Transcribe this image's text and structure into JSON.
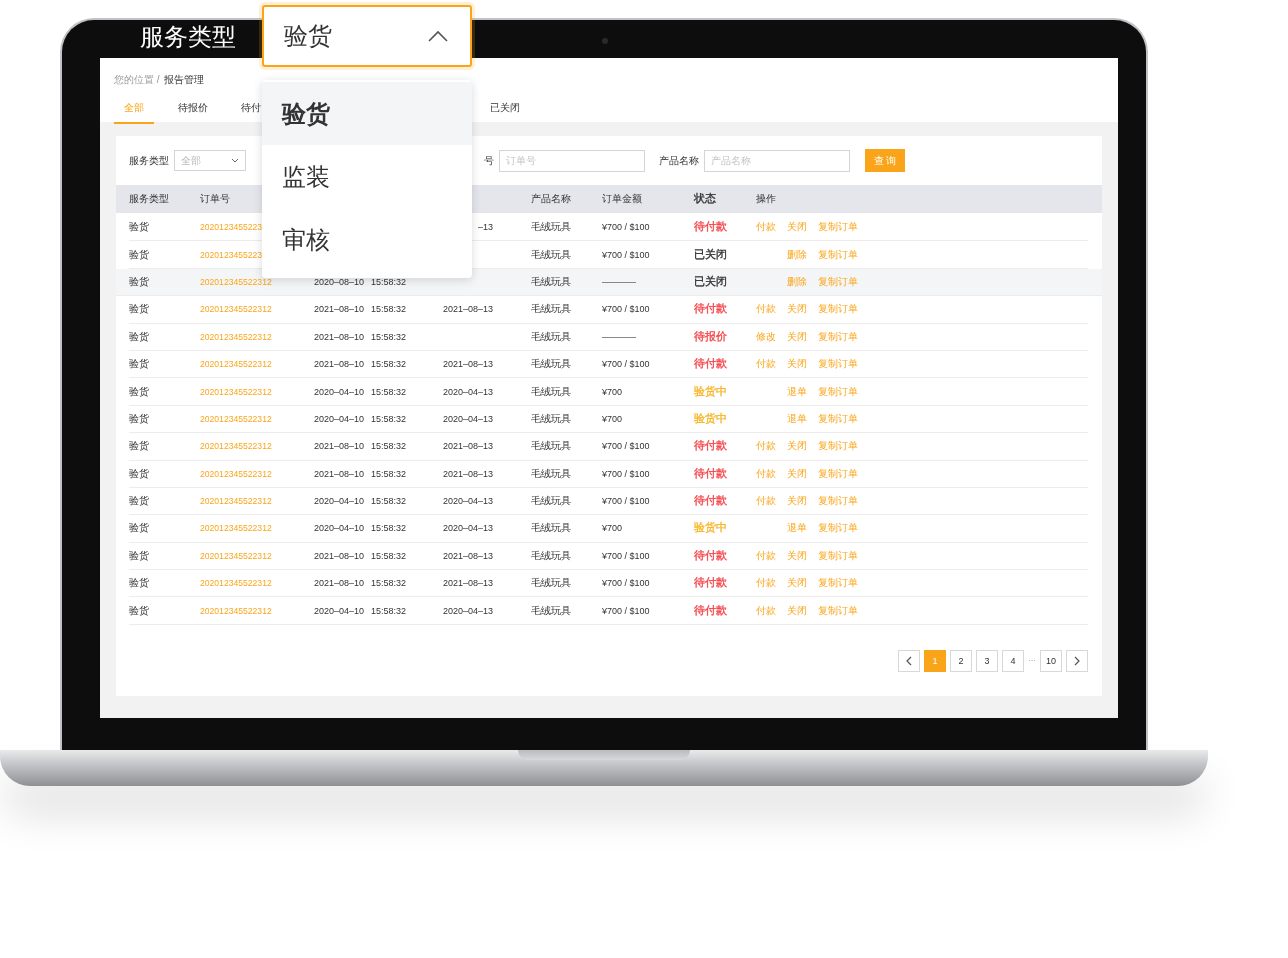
{
  "zoom_overlay": {
    "label": "服务类型",
    "field": {
      "value": "验货",
      "expanded": true
    },
    "options": [
      {
        "label": "验货",
        "selected": true
      },
      {
        "label": "监装",
        "selected": false
      },
      {
        "label": "审核",
        "selected": false
      }
    ]
  },
  "breadcrumb": {
    "trail": "您的位置 /",
    "current": "报告管理"
  },
  "tabs": [
    {
      "label": "全部",
      "selected": true
    },
    {
      "label": "待报价",
      "selected": false
    },
    {
      "label": "待付",
      "selected": false
    },
    {
      "label": "已关闭",
      "selected": false
    }
  ],
  "filters": {
    "service_label": "服务类型",
    "service_value": "全部",
    "order_label": "号",
    "order_placeholder": "订单号",
    "product_label": "产品名称",
    "product_placeholder": "产品名称",
    "search_button": "查 询"
  },
  "table": {
    "columns": [
      "服务类型",
      "订单号",
      "产品名称",
      "订单金额",
      "状态",
      "操作"
    ],
    "rows": [
      {
        "service": "验货",
        "order": "2020123455223",
        "deadline": "–13",
        "product": "毛绒玩具",
        "amount": "¥700 / $100",
        "status": {
          "label": "待付款",
          "color": "#f5464b"
        },
        "actions": [
          "付款",
          "关闭",
          "复制订单"
        ],
        "hovered": false
      },
      {
        "service": "验货",
        "order": "2020123455223",
        "product": "毛绒玩具",
        "amount": "¥700 / $100",
        "status": {
          "label": "已关闭",
          "color": "#333333"
        },
        "actions": [
          "删除",
          "复制订单"
        ],
        "hovered": false
      },
      {
        "service": "验货",
        "order": "202012345522312",
        "date": "2020–08–10",
        "time": "15:58:32",
        "product": "毛绒玩具",
        "status": {
          "label": "已关闭",
          "color": "#333333"
        },
        "actions": [
          "删除",
          "复制订单"
        ],
        "hovered": true
      },
      {
        "service": "验货",
        "order": "202012345522312",
        "date": "2021–08–10",
        "time": "15:58:32",
        "deadline": "2021–08–13",
        "product": "毛绒玩具",
        "amount": "¥700 / $100",
        "status": {
          "label": "待付款",
          "color": "#f5464b"
        },
        "actions": [
          "付款",
          "关闭",
          "复制订单"
        ],
        "hovered": false
      },
      {
        "service": "验货",
        "order": "202012345522312",
        "date": "2021–08–10",
        "time": "15:58:32",
        "product": "毛绒玩具",
        "status": {
          "label": "待报价",
          "color": "#f5464b"
        },
        "actions": [
          "修改",
          "关闭",
          "复制订单"
        ],
        "hovered": false
      },
      {
        "service": "验货",
        "order": "202012345522312",
        "date": "2021–08–10",
        "time": "15:58:32",
        "deadline": "2021–08–13",
        "product": "毛绒玩具",
        "amount": "¥700 / $100",
        "status": {
          "label": "待付款",
          "color": "#f5464b"
        },
        "actions": [
          "付款",
          "关闭",
          "复制订单"
        ],
        "hovered": false
      },
      {
        "service": "验货",
        "order": "202012345522312",
        "date": "2020–04–10",
        "time": "15:58:32",
        "deadline": "2020–04–13",
        "product": "毛绒玩具",
        "amount": "¥700",
        "status": {
          "label": "验货中",
          "color": "#f8b526"
        },
        "actions": [
          "退单",
          "复制订单"
        ],
        "hovered": false
      },
      {
        "service": "验货",
        "order": "202012345522312",
        "date": "2020–04–10",
        "time": "15:58:32",
        "deadline": "2020–04–13",
        "product": "毛绒玩具",
        "amount": "¥700",
        "status": {
          "label": "验货中",
          "color": "#f8b526"
        },
        "actions": [
          "退单",
          "复制订单"
        ],
        "hovered": false
      },
      {
        "service": "验货",
        "order": "202012345522312",
        "date": "2021–08–10",
        "time": "15:58:32",
        "deadline": "2021–08–13",
        "product": "毛绒玩具",
        "amount": "¥700 / $100",
        "status": {
          "label": "待付款",
          "color": "#f5464b"
        },
        "actions": [
          "付款",
          "关闭",
          "复制订单"
        ],
        "hovered": false
      },
      {
        "service": "验货",
        "order": "202012345522312",
        "date": "2021–08–10",
        "time": "15:58:32",
        "deadline": "2021–08–13",
        "product": "毛绒玩具",
        "amount": "¥700 / $100",
        "status": {
          "label": "待付款",
          "color": "#f5464b"
        },
        "actions": [
          "付款",
          "关闭",
          "复制订单"
        ],
        "hovered": false
      },
      {
        "service": "验货",
        "order": "202012345522312",
        "date": "2020–04–10",
        "time": "15:58:32",
        "deadline": "2020–04–13",
        "product": "毛绒玩具",
        "amount": "¥700 / $100",
        "status": {
          "label": "待付款",
          "color": "#f5464b"
        },
        "actions": [
          "付款",
          "关闭",
          "复制订单"
        ],
        "hovered": false
      },
      {
        "service": "验货",
        "order": "202012345522312",
        "date": "2020–04–10",
        "time": "15:58:32",
        "deadline": "2020–04–13",
        "product": "毛绒玩具",
        "amount": "¥700",
        "status": {
          "label": "验货中",
          "color": "#f8b526"
        },
        "actions": [
          "退单",
          "复制订单"
        ],
        "hovered": false
      },
      {
        "service": "验货",
        "order": "202012345522312",
        "date": "2021–08–10",
        "time": "15:58:32",
        "deadline": "2021–08–13",
        "product": "毛绒玩具",
        "amount": "¥700 / $100",
        "status": {
          "label": "待付款",
          "color": "#f5464b"
        },
        "actions": [
          "付款",
          "关闭",
          "复制订单"
        ],
        "hovered": false
      },
      {
        "service": "验货",
        "order": "202012345522312",
        "date": "2021–08–10",
        "time": "15:58:32",
        "deadline": "2021–08–13",
        "product": "毛绒玩具",
        "amount": "¥700 / $100",
        "status": {
          "label": "待付款",
          "color": "#f5464b"
        },
        "actions": [
          "付款",
          "关闭",
          "复制订单"
        ],
        "hovered": false
      },
      {
        "service": "验货",
        "order": "202012345522312",
        "date": "2020–04–10",
        "time": "15:58:32",
        "deadline": "2020–04–13",
        "product": "毛绒玩具",
        "amount": "¥700 / $100",
        "status": {
          "label": "待付款",
          "color": "#f5464b"
        },
        "actions": [
          "付款",
          "关闭",
          "复制订单"
        ],
        "hovered": false
      }
    ]
  },
  "pagination": [
    {
      "kind": "page",
      "label": "1",
      "selected": true
    },
    {
      "kind": "page",
      "label": "2",
      "selected": false
    },
    {
      "kind": "page",
      "label": "3",
      "selected": false
    },
    {
      "kind": "page",
      "label": "4",
      "selected": false
    },
    {
      "kind": "ellipsis",
      "label": "···"
    },
    {
      "kind": "page",
      "label": "10",
      "selected": false
    }
  ]
}
